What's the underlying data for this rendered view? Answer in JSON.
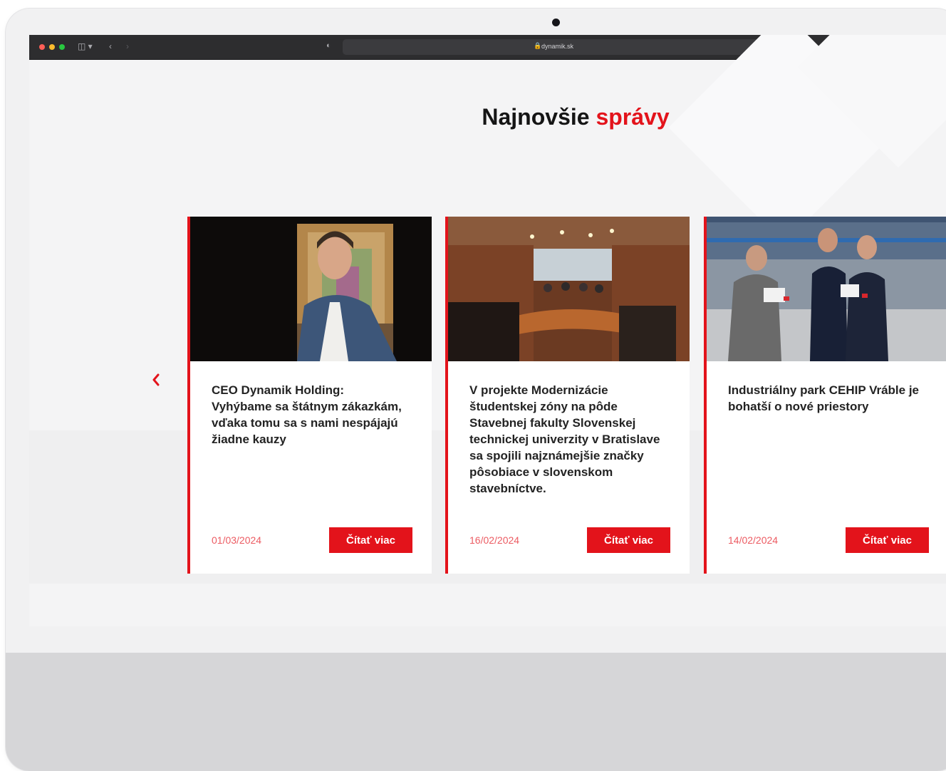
{
  "browser": {
    "url": "dynamik.sk"
  },
  "section": {
    "title_main": "Najnovšie",
    "title_accent": "správy"
  },
  "colors": {
    "accent": "#e3131b",
    "date": "#ec5b62",
    "title": "#151515"
  },
  "icons": {
    "prev": "chevron-left-icon",
    "lock": "lock-icon",
    "reload": "reload-icon",
    "sidebar": "sidebar-toggle-icon"
  },
  "news": [
    {
      "title": "CEO Dynamik Holding: Vyhýbame sa štátnym zákazkám, vďaka tomu sa s nami nespájajú žiadne kauzy",
      "date": "01/03/2024",
      "button": "Čítať viac"
    },
    {
      "title": "V projekte Modernizácie študentskej zóny na pôde Stavebnej fakulty Slovenskej technickej univerzity v Bratislave sa spojili najznámejšie značky pôsobiace v slovenskom stavebníctve.",
      "date": "16/02/2024",
      "button": "Čítať viac"
    },
    {
      "title": "Industriálny park CEHIP Vráble je bohatší o nové priestory",
      "date": "14/02/2024",
      "button": "Čítať viac"
    }
  ]
}
